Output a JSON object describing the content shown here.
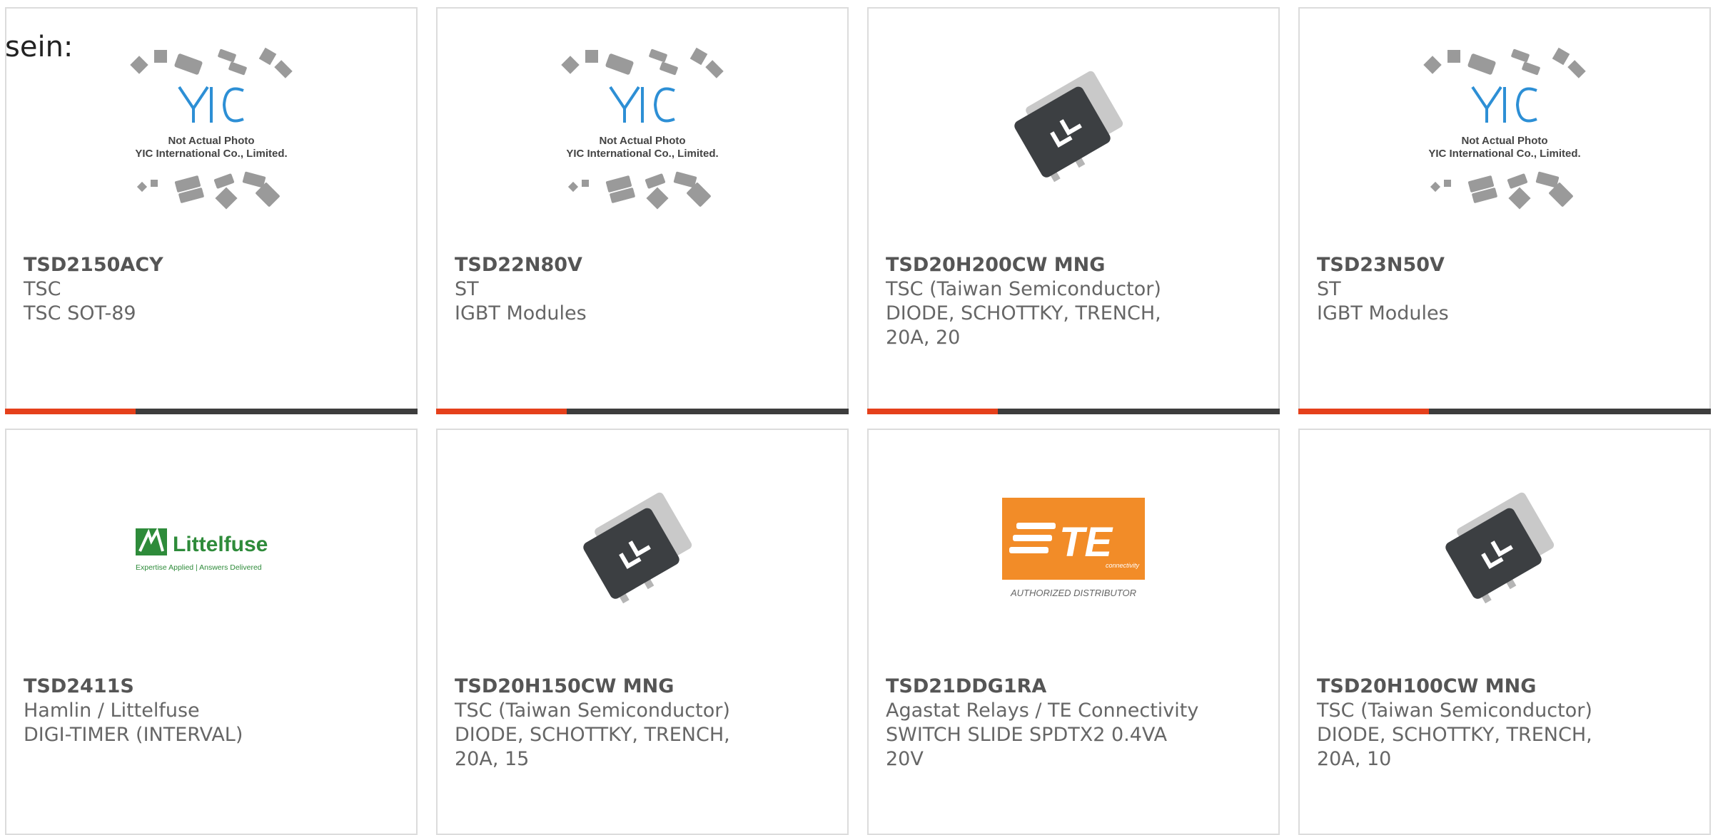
{
  "lead_text": "sein:",
  "products": [
    {
      "part": "TSD2150ACY",
      "maker": "TSC",
      "desc": [
        "TSC SOT-89"
      ],
      "image": "yic-placeholder",
      "placeholder": {
        "line1": "Not Actual Photo",
        "line2": "YIC International Co., Limited."
      }
    },
    {
      "part": "TSD22N80V",
      "maker": "ST",
      "desc": [
        "IGBT Modules"
      ],
      "image": "yic-placeholder",
      "placeholder": {
        "line1": "Not Actual Photo",
        "line2": "YIC International Co., Limited."
      }
    },
    {
      "part": "TSD20H200CW MNG",
      "maker": "TSC (Taiwan Semiconductor)",
      "desc": [
        "DIODE, SCHOTTKY, TRENCH,",
        "20A, 20"
      ],
      "image": "to263-chip"
    },
    {
      "part": "TSD23N50V",
      "maker": "ST",
      "desc": [
        "IGBT Modules"
      ],
      "image": "yic-placeholder",
      "placeholder": {
        "line1": "Not Actual Photo",
        "line2": "YIC International Co., Limited."
      }
    },
    {
      "part": "TSD2411S",
      "maker": "Hamlin / Littelfuse",
      "desc": [
        "DIGI-TIMER (INTERVAL)"
      ],
      "image": "littelfuse-logo",
      "logo": {
        "brand": "Littelfuse",
        "tagline": "Expertise Applied | Answers Delivered"
      }
    },
    {
      "part": "TSD20H150CW MNG",
      "maker": "TSC (Taiwan Semiconductor)",
      "desc": [
        "DIODE, SCHOTTKY, TRENCH,",
        "20A, 15"
      ],
      "image": "to263-chip"
    },
    {
      "part": "TSD21DDG1RA",
      "maker": "Agastat Relays / TE Connectivity",
      "desc": [
        "SWITCH SLIDE SPDTX2 0.4VA",
        "20V"
      ],
      "image": "te-logo",
      "logo": {
        "brand": "TE",
        "sub": "connectivity",
        "tagline": "AUTHORIZED DISTRIBUTOR"
      }
    },
    {
      "part": "TSD20H100CW MNG",
      "maker": "TSC (Taiwan Semiconductor)",
      "desc": [
        "DIODE, SCHOTTKY, TRENCH,",
        "20A, 10"
      ],
      "image": "to263-chip"
    }
  ],
  "colors": {
    "accent": "#e5401b",
    "bar": "#3d3d3d",
    "te_orange": "#f28c28",
    "littelfuse_green": "#2e8b3a"
  }
}
